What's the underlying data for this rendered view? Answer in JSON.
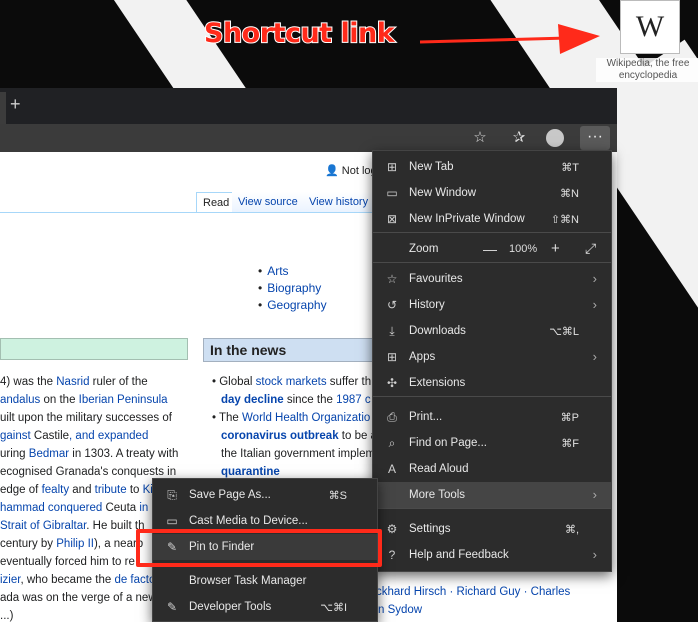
{
  "annotation": {
    "label": "Shortcut link",
    "color": "#ff2a1a"
  },
  "desktop_shortcut": {
    "icon_letter": "W",
    "label": "Wikipedia, the free encyclopedia"
  },
  "browser": {
    "new_tab_glyph": "+",
    "toolbar_icons": [
      "star-icon",
      "favorites-icon",
      "profile-icon",
      "more-icon"
    ],
    "more_glyph": "···"
  },
  "page": {
    "not_logged_in": "Not logg",
    "tabs": [
      "Read",
      "View source",
      "View history"
    ],
    "portal_links": [
      "Arts",
      "Biography",
      "Geography"
    ],
    "news_title": "In the news",
    "featured_lines": [
      [
        "4) was the ",
        "Nasrid",
        " ruler of the"
      ],
      [
        "andalus",
        " on the ",
        "Iberian Peninsula"
      ],
      [
        "uilt upon the military successes of"
      ],
      [
        "gainst ",
        "Castile",
        ", and expanded"
      ],
      [
        "uring ",
        "Bedmar",
        " in 1303. A treaty with"
      ],
      [
        "ecognised Granada's conquests in"
      ],
      [
        "edge of ",
        "fealty",
        " and ",
        "tribute",
        " to ",
        "Kin"
      ],
      [
        "hammad conquered ",
        "Ceuta",
        " in N"
      ],
      [
        "Strait of Gibraltar",
        ". He built th"
      ],
      [
        "century by ",
        "Philip II",
        "), a nearb"
      ],
      [
        " eventually forced him to re"
      ],
      [
        "izier",
        ", who became the ",
        "de facto"
      ],
      [
        "ada was on the verge of a new"
      ],
      [
        "...)"
      ]
    ],
    "news_lines": [
      [
        "Global ",
        "stock markets",
        " suffer th"
      ],
      [
        "day decline",
        " since the ",
        "1987 c"
      ],
      [
        "The ",
        "World Health Organizatio"
      ],
      [
        "coronavirus outbreak",
        " to be a"
      ],
      [
        "the Italian government implem"
      ],
      [
        "quarantine"
      ]
    ],
    "bottom_names": "ckhard Hirsch · Richard Guy · Charles",
    "bottom_names2": "n Sydow"
  },
  "menu": {
    "items": [
      {
        "icon": "new-tab-icon",
        "glyph": "⊞",
        "label": "New Tab",
        "shortcut": "⌘T"
      },
      {
        "icon": "new-window-icon",
        "glyph": "▭",
        "label": "New Window",
        "shortcut": "⌘N"
      },
      {
        "icon": "inprivate-icon",
        "glyph": "⊠",
        "label": "New InPrivate Window",
        "shortcut": "⇧⌘N"
      },
      {
        "icon": "zoom-icon",
        "glyph": "",
        "label": "Zoom",
        "shortcut": ""
      },
      {
        "icon": "favourites-icon",
        "glyph": "☆",
        "label": "Favourites",
        "shortcut": ""
      },
      {
        "icon": "history-icon",
        "glyph": "↺",
        "label": "History",
        "shortcut": ""
      },
      {
        "icon": "downloads-icon",
        "glyph": "⤓",
        "label": "Downloads",
        "shortcut": "⌥⌘L"
      },
      {
        "icon": "apps-icon",
        "glyph": "⊞",
        "label": "Apps",
        "shortcut": ""
      },
      {
        "icon": "extensions-icon",
        "glyph": "✣",
        "label": "Extensions",
        "shortcut": ""
      },
      {
        "icon": "print-icon",
        "glyph": "⎙",
        "label": "Print...",
        "shortcut": "⌘P"
      },
      {
        "icon": "find-icon",
        "glyph": "⌕",
        "label": "Find on Page...",
        "shortcut": "⌘F"
      },
      {
        "icon": "read-aloud-icon",
        "glyph": "A",
        "label": "Read Aloud",
        "shortcut": ""
      },
      {
        "icon": "more-tools-icon",
        "glyph": "",
        "label": "More Tools",
        "shortcut": ""
      },
      {
        "icon": "settings-icon",
        "glyph": "⚙",
        "label": "Settings",
        "shortcut": "⌘,"
      },
      {
        "icon": "help-icon",
        "glyph": "?",
        "label": "Help and Feedback",
        "shortcut": ""
      }
    ],
    "zoom": {
      "minus": "—",
      "value": "100%",
      "plus": "+",
      "fullscreen": "⤢"
    }
  },
  "submenu": {
    "items": [
      {
        "icon": "save-page-icon",
        "glyph": "⎘",
        "label": "Save Page As...",
        "shortcut": "⌘S"
      },
      {
        "icon": "cast-icon",
        "glyph": "▭",
        "label": "Cast Media to Device...",
        "shortcut": ""
      },
      {
        "icon": "pin-icon",
        "glyph": "✎",
        "label": "Pin to Finder",
        "shortcut": ""
      },
      {
        "icon": "",
        "glyph": "",
        "label": "Browser Task Manager",
        "shortcut": ""
      },
      {
        "icon": "developer-tools-icon",
        "glyph": "✎",
        "label": "Developer Tools",
        "shortcut": "⌥⌘I"
      }
    ]
  }
}
